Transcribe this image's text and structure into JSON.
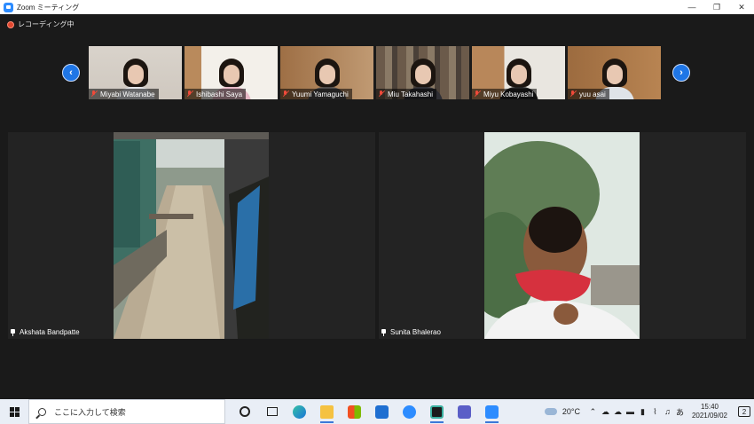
{
  "window": {
    "title": "Zoom ミーティング"
  },
  "recording": {
    "label": "レコーディング中"
  },
  "gallery": {
    "participants": [
      {
        "name": "Miyabi Watanabe",
        "muted": true
      },
      {
        "name": "Ishibashi Saya",
        "muted": true
      },
      {
        "name": "Yuumi Yamaguchi",
        "muted": true
      },
      {
        "name": "Miu Takahashi",
        "muted": true
      },
      {
        "name": "Miyu Kobayashi",
        "muted": true
      },
      {
        "name": "yuu asai",
        "muted": true
      }
    ]
  },
  "main_videos": [
    {
      "name": "Akshata Bandpatte"
    },
    {
      "name": "Sunita Bhalerao"
    }
  ],
  "taskbar": {
    "search_placeholder": "ここに入力して検索",
    "apps": [
      "cortana-icon",
      "task-view-icon",
      "edge-icon",
      "file-explorer-icon",
      "store-icon",
      "mail-icon",
      "zoom-meetings-icon",
      "snip-icon",
      "teams-icon",
      "zoom-icon"
    ],
    "weather": "20°C",
    "ime": "あ",
    "time": "15:40",
    "date": "2021/09/02",
    "notifications": "2"
  },
  "colors": {
    "accent": "#2d8cff",
    "recording": "#e0472f",
    "muted": "#f04a3a"
  }
}
